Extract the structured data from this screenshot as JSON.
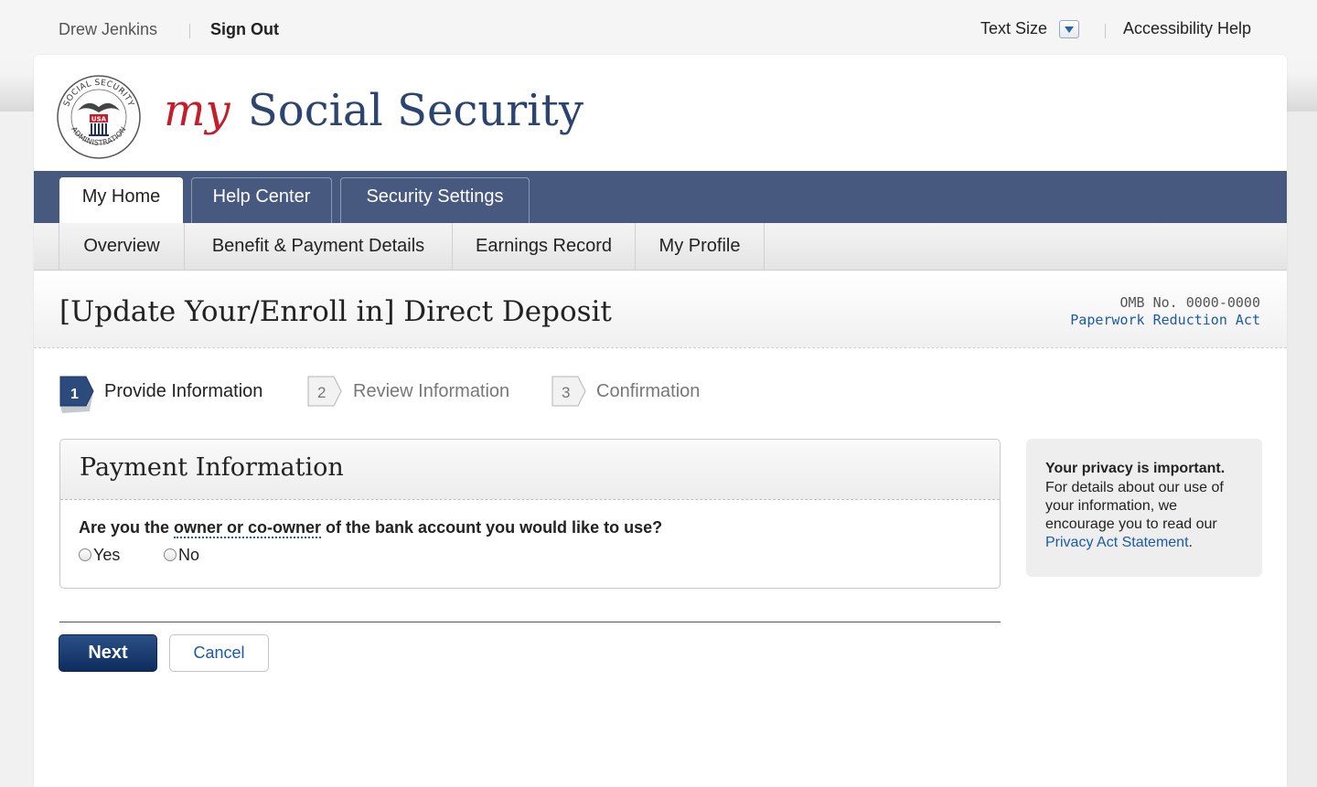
{
  "utility": {
    "user_name": "Drew Jenkins",
    "sign_out": "Sign Out",
    "text_size": "Text Size",
    "accessibility_help": "Accessibility Help"
  },
  "brand": {
    "my": "my",
    "name": "Social Security",
    "seal_text_top": "SOCIAL SECURITY",
    "seal_text_bottom": "ADMINISTRATION",
    "seal_center": "USA"
  },
  "primary_tabs": [
    {
      "label": "My Home",
      "active": true
    },
    {
      "label": "Help Center",
      "active": false
    },
    {
      "label": "Security Settings",
      "active": false
    }
  ],
  "sub_nav": [
    {
      "label": "Overview"
    },
    {
      "label": "Benefit & Payment Details"
    },
    {
      "label": "Earnings Record"
    },
    {
      "label": "My Profile"
    }
  ],
  "page": {
    "title": "[Update Your/Enroll in] Direct Deposit",
    "omb": "OMB No. 0000-0000",
    "paperwork_link": "Paperwork Reduction Act"
  },
  "steps": [
    {
      "number": "1",
      "label": "Provide Information",
      "active": true
    },
    {
      "number": "2",
      "label": "Review Information",
      "active": false
    },
    {
      "number": "3",
      "label": "Confirmation",
      "active": false
    }
  ],
  "payment_panel": {
    "title": "Payment Information",
    "question_before": "Are you the ",
    "question_term": "owner or co-owner",
    "question_after": " of the bank account you would like to use?",
    "options": [
      {
        "label": "Yes"
      },
      {
        "label": "No"
      }
    ]
  },
  "actions": {
    "next": "Next",
    "cancel": "Cancel"
  },
  "privacy": {
    "heading": "Your privacy is important.",
    "body": "For details about our use of your information, we encourage you to read our ",
    "link": "Privacy Act Statement",
    "end": "."
  },
  "colors": {
    "nav_bg": "#48597f",
    "brand_blue": "#2b4470",
    "brand_red": "#c41e2b",
    "link": "#1a5aa8",
    "button_primary": "#163a70"
  }
}
